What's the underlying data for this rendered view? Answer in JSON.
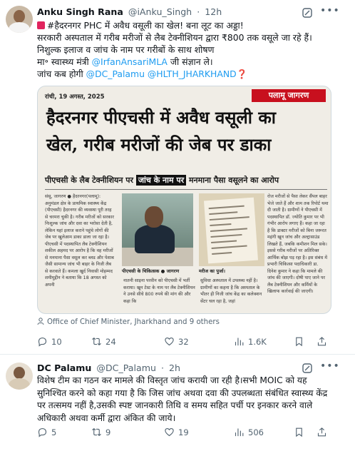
{
  "tweets": [
    {
      "author_name": "Anku Singh Rana",
      "handle": "@iAnku_Singh",
      "time": "12h",
      "lines": {
        "l1_text": "#हैदरनगर PHC में अवैध वसूली का खेल! बना लूट का अड्डा!",
        "l2_text": "सरकारी अस्पताल में गरीब मरीजों से लैब टेक्नीशियन द्वारा ₹800 तक वसूले जा रहे हैं।",
        "l3_text": "निशुल्क इलाज व जांच के नाम पर गरीबों के साथ शोषण",
        "l4_prefix": "मा॰ स्वास्थ्य मंत्री",
        "l4_mention": "@IrfanAnsariMLA",
        "l4_suffix": "जी संज्ञान ले।",
        "l5_prefix": "जांच कब होगी",
        "l5_mention1": "@DC_Palamu",
        "l5_mention2": "@HLTH_JHARKHAND",
        "l5_emoji": "❓"
      },
      "image": {
        "date": "रांची, 19 अगस्त, 2025",
        "brand": "पलामू जागरण",
        "headline_1": "हैदरनगर पीएचसी में अवैध वसूली का",
        "headline_2": "खेल, गरीब मरीजों की जेब पर डाका",
        "sub_pre": "पीएचसी के लैब टेक्नीशियन पर",
        "sub_hl": "जांच के नाम पर",
        "sub_post": "मनमाना पैसा वसूलने का आरोप",
        "col1": "संसू, जागरण ● हैदरनगर(पलामू): अनुमंडल क्षेत्र के प्राथमिक स्वास्थ्य केंद्र (पीएचसी) हैदरनगर की व्यवस्था पूरी तरह से चरमरा चुकी है। गरीब मरीजों को सरकार निःशुल्क जांच और दवा का भरोसा देती है, लेकिन यहां इलाज कराने पहुंचे लोगों की जेब पर खुलेआम डाका डाला जा रहा है। पीएचसी में पदस्थापित लैब टेक्नीशियन शकील अहमद पर आरोप है कि वह मरीजों से मनमाना पैसा वसूल कर ब्लड और पेशाब जैसी सामान्य जांच भी बाहर के निजी लैब से करवाते हैं। कमला खुर्द निवासी मोहम्मद शमीमुद्दीन ने बताया कि 18 अगस्त को अपनी",
        "col3": "रोज मरीजों से पैसा लेकर सैंपल बाहर भेजे जाते हैं और शाम तक रिपोर्ट थमा दी जाती है। ग्रामीणों ने पीएचसी में पदस्थापित डॉ. ज्योति कुमार पर भी गंभीर आरोप लगाए हैं। कहा जा रहा है कि डाक्टर मरीजों को बिना जरूरत महंगी खून जांच और अल्ट्रासाउंड लिखते हैं, जबकि कमीशन मिल सके। इससे गरीब मरीजों पर अतिरिक्त आर्थिक बोझ पड़ रहा है। इस संबंध में प्रभारी चिकित्सा पदाधिकारी डा. दिनेश कुमार ने कहा कि मामले की जांच की जाएगी। दोषी पाए जाने पर लैब टेक्नीशियन और कर्मियों के खिलाफ कार्रवाई की जाएगी।",
        "colb": "नातनी साइना परवीन को पीएचसी में भर्ती कराया। खून टेस्ट के नाम पर लैब टेक्नीशियन ने उनसे सीधे 800 रुपये की मांग की और कहा कि",
        "colc": "सुविधा अस्पताल में उपलब्ध नहीं है। ग्रामीणों का कहना है कि अस्पताल के भीतर ही निजी जांच केंद्र का कलेक्शन सेंटर चल रहा है, जहां",
        "cap1": "पीएचसी के चिकित्सक ● जागरण",
        "cap2": "मरीज का पुर्जा।"
      },
      "credit": "Office of Chief Minister, Jharkhand and 9 others",
      "stats": {
        "replies": "10",
        "retweets": "24",
        "likes": "32",
        "views": "1.6K"
      }
    },
    {
      "author_name": "DC Palamu",
      "handle": "@DC_Palamu",
      "time": "2h",
      "lines": {
        "l1_text": "विशेष टीम का गठन कर मामले की विस्तृत जांच करायी जा रही है।सभी MOIC को यह",
        "l2_text": "सुनिश्चित करने को कहा गया है कि जिस जांच अथवा दवा की उपलब्धता संबंधित स्वास्थ्य केंद्र",
        "l3_text": "पर तत्समय नहीं है,उसकी स्पष्ट जानकारी तिथि व समय सहित पर्ची पर इनकार करने वाले",
        "l4_text": "अधिकारी अथवा कर्मी द्वारा अंकित की जाये।"
      },
      "stats": {
        "replies": "5",
        "retweets": "9",
        "likes": "19",
        "views": "506"
      }
    }
  ],
  "icons": {
    "reply": "reply-icon",
    "retweet": "retweet-icon",
    "like": "like-icon",
    "views": "views-icon",
    "bookmark": "bookmark-icon",
    "share": "share-icon",
    "grok": "grok-icon",
    "more": "more-icon"
  },
  "colors": {
    "link": "#1d9bf0",
    "text": "#0f1419",
    "muted": "#536471",
    "brand_red": "#c8101e"
  }
}
